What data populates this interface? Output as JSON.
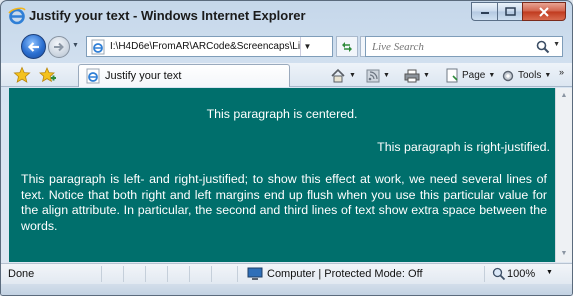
{
  "window": {
    "title": "Justify your text - Windows Internet Explorer"
  },
  "toolbar": {
    "address": "I:\\H4D6e\\FromAR\\ARCode&Screencaps\\Li",
    "search_placeholder": "Live Search"
  },
  "tabs": [
    {
      "label": "Justify your text"
    }
  ],
  "commands": {
    "page": "Page",
    "tools": "Tools",
    "more": "»"
  },
  "content": {
    "background": "#006f6c",
    "text_color": "#ffffff",
    "para_center": "This paragraph is centered.",
    "para_right": "This paragraph is right-justified.",
    "para_justify": "This paragraph is left- and right-justified; to show this effect at work, we need several lines of text. Notice that both right and left margins end up flush when you use this particular value for the align attribute. In particular, the second and third lines of text show extra space between the words."
  },
  "status": {
    "text": "Done",
    "zone": "Computer | Protected Mode: Off",
    "zoom": "100%"
  },
  "icons": {
    "title": "ie-logo-icon",
    "back": "back-arrow-icon",
    "forward": "forward-arrow-icon",
    "refresh": "refresh-icon",
    "stop": "stop-icon",
    "search": "search-icon",
    "favorites": "favorites-star-icon",
    "add_favorites": "add-favorites-icon",
    "home": "home-icon",
    "feeds": "feeds-icon",
    "print": "print-icon",
    "computer": "computer-icon",
    "zoom": "zoom-icon"
  }
}
